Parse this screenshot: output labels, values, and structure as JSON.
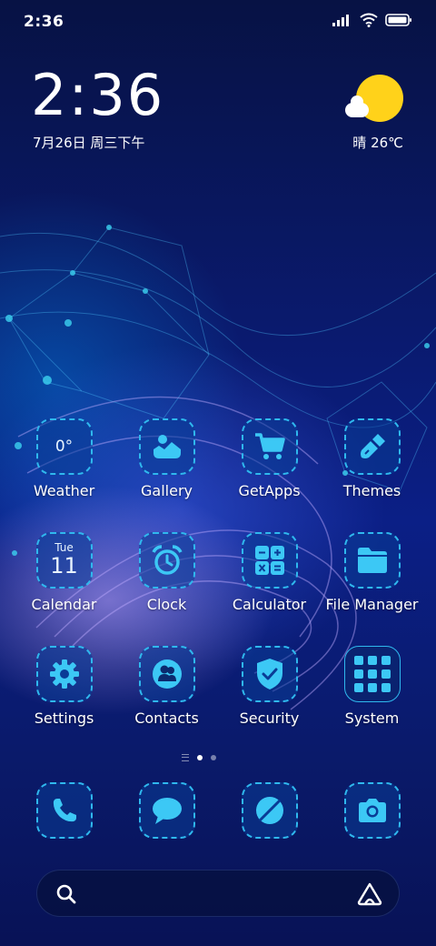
{
  "status_bar": {
    "time": "2:36"
  },
  "lockclock": {
    "time": "2:36",
    "date": "7月26日 周三下午"
  },
  "weather": {
    "text": "晴 26℃"
  },
  "apps": [
    {
      "label": "Weather",
      "icon": "weather-icon",
      "glyph": "0°"
    },
    {
      "label": "Gallery",
      "icon": "gallery-icon"
    },
    {
      "label": "GetApps",
      "icon": "cart-icon"
    },
    {
      "label": "Themes",
      "icon": "brush-icon"
    },
    {
      "label": "Calendar",
      "icon": "calendar-icon",
      "day": "Tue",
      "date": "11"
    },
    {
      "label": "Clock",
      "icon": "alarm-clock-icon"
    },
    {
      "label": "Calculator",
      "icon": "calculator-icon"
    },
    {
      "label": "File Manager",
      "icon": "folder-icon"
    },
    {
      "label": "Settings",
      "icon": "gear-icon"
    },
    {
      "label": "Contacts",
      "icon": "contacts-icon"
    },
    {
      "label": "Security",
      "icon": "shield-check-icon"
    },
    {
      "label": "System",
      "icon": "folder-grid-icon"
    }
  ],
  "dock": [
    {
      "icon": "phone-icon"
    },
    {
      "icon": "message-icon"
    },
    {
      "icon": "browser-icon"
    },
    {
      "icon": "camera-icon"
    }
  ],
  "colors": {
    "accent": "#2fb8ee",
    "icon_fill": "#3cc8f5",
    "sun": "#ffd21a"
  }
}
